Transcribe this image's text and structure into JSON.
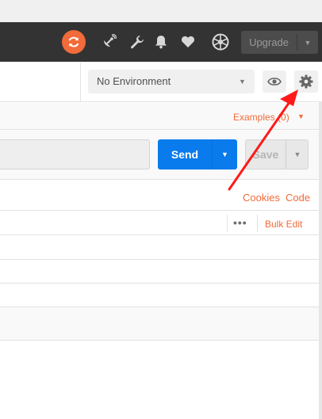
{
  "header": {
    "icons": [
      "sync-icon",
      "satellite-icon",
      "wrench-icon",
      "bell-icon",
      "heart-icon",
      "user-icon"
    ],
    "upgrade_label": "Upgrade"
  },
  "environment": {
    "selected": "No Environment",
    "icons": [
      "eye-icon",
      "gear-icon"
    ]
  },
  "request": {
    "examples_label": "Examples (0)",
    "url_value": "",
    "send_label": "Send",
    "save_label": "Save"
  },
  "links": {
    "cookies": "Cookies",
    "code": "Code"
  },
  "params": {
    "more_label": "•••",
    "bulk_edit_label": "Bulk Edit",
    "rows": 3
  },
  "colors": {
    "header_bg": "#333333",
    "accent_orange": "#f26b3a",
    "send_blue": "#097bed",
    "annotation_red": "#ff1a1a"
  }
}
